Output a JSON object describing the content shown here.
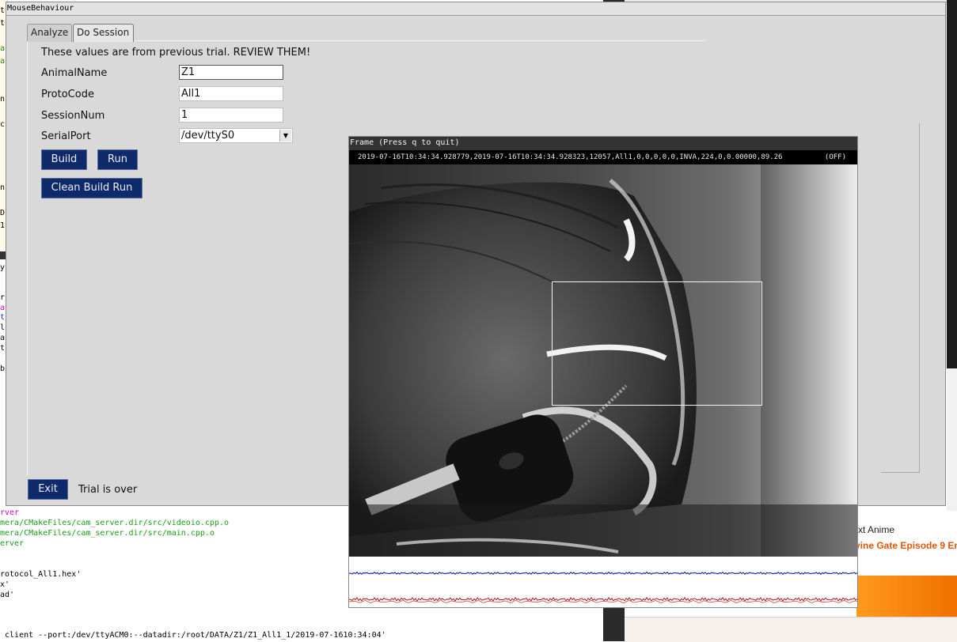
{
  "main_window": {
    "title": "MouseBehaviour",
    "tabs": [
      {
        "label": "Analyze"
      },
      {
        "label": "Do Session"
      }
    ],
    "notice": "These values are from previous trial. REVIEW THEM!",
    "fields": {
      "animal_name": {
        "label": "AnimalName",
        "value": "Z1"
      },
      "proto_code": {
        "label": "ProtoCode",
        "value": "All1"
      },
      "session_num": {
        "label": "SessionNum",
        "value": "1"
      },
      "serial_port": {
        "label": "SerialPort",
        "value": "/dev/ttyS0"
      }
    },
    "buttons": {
      "build": "Build",
      "run": "Run",
      "clean_build_run": "Clean Build Run",
      "exit": "Exit"
    },
    "trial_status": "Trial is over",
    "button_color": "#0f2a6a"
  },
  "frame_window": {
    "title": "Frame (Press q to quit)",
    "overlay_text": "2019-07-16T10:34:34.928779,2019-07-16T10:34:34.928323,12057,All1,0,0,0,0,0,INVA,224,0,0.00000,89.26",
    "overlay_status": "(OFF)"
  },
  "terminal": {
    "lines": [
      {
        "text": "rver",
        "color": "#c000c0"
      },
      {
        "text": "mera/CMakeFiles/cam_server.dir/src/videoio.cpp.o",
        "color": "#1a9c1a"
      },
      {
        "text": "mera/CMakeFiles/cam_server.dir/src/main.cpp.o",
        "color": "#1a9c1a"
      },
      {
        "text": "erver",
        "color": "#1a9c1a"
      },
      {
        "text": "rotocol_All1.hex'",
        "color": "#000000"
      },
      {
        "text": "x'",
        "color": "#000000"
      },
      {
        "text": "ad'",
        "color": "#000000"
      },
      {
        "text": " client --port:/dev/ttyACM0:--datadir:/root/DATA/Z1/Z1_All1_1/2019-07-1610:34:04'",
        "color": "#000000"
      }
    ]
  },
  "browser": {
    "anime_title": "xt Anime",
    "anime_link": "vine Gate Episode 9 En"
  }
}
